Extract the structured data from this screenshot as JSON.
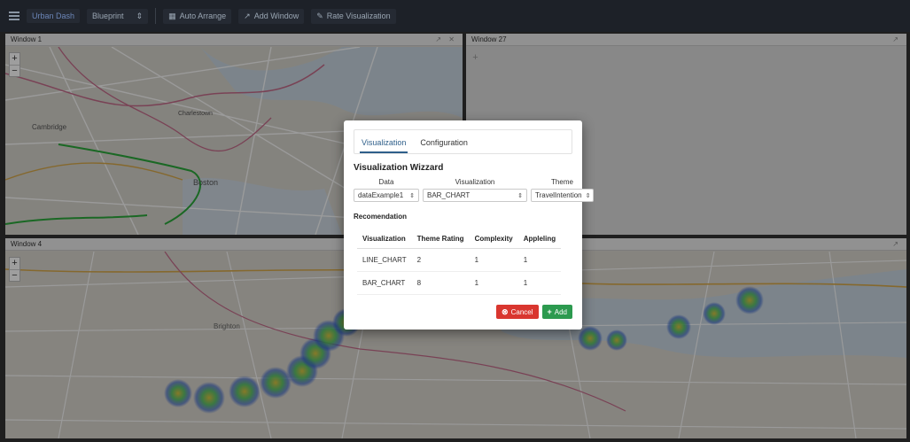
{
  "toolbar": {
    "brand": "Urban Dash",
    "blueprint": "Blueprint",
    "auto_arrange": "Auto Arrange",
    "add_window": "Add Window",
    "rate_visualization": "Rate Visualization"
  },
  "windows": {
    "w1": {
      "title": "Window 1"
    },
    "w27": {
      "title": "Window 27"
    },
    "w4": {
      "title": "Window 4"
    }
  },
  "map_labels": {
    "cambridge": "Cambridge",
    "boston": "Boston",
    "charlestown": "Charlestown",
    "brighton": "Brighton"
  },
  "modal": {
    "tabs": [
      "Visualization",
      "Configuration"
    ],
    "title": "Visualization Wizzard",
    "data_label": "Data",
    "data_value": "dataExample1",
    "vis_label": "Visualization",
    "vis_value": "BAR_CHART",
    "theme_label": "Theme",
    "theme_value": "TravelIntention",
    "reco_title": "Recomendation",
    "columns": [
      "Visualization",
      "Theme Rating",
      "Complexity",
      "Appleling"
    ],
    "rows": [
      [
        "LINE_CHART",
        "2",
        "1",
        "1"
      ],
      [
        "BAR_CHART",
        "8",
        "1",
        "1"
      ]
    ],
    "cancel": "Cancel",
    "add": "Add"
  },
  "colors": {
    "toolbar_bg": "#1d2128",
    "cancel": "#d9362f",
    "add": "#2c9a4f",
    "active_tab": "#2f5f8a"
  }
}
